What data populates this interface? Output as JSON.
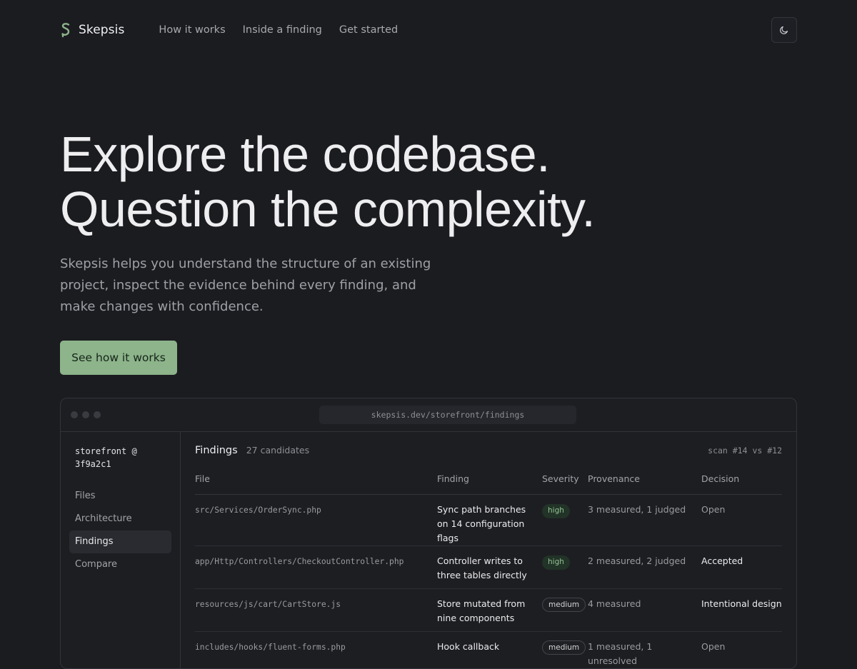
{
  "brand": {
    "name": "Skepsis",
    "accent": "#8db48a"
  },
  "nav": {
    "links": [
      "How it works",
      "Inside a finding",
      "Get started"
    ],
    "theme_icon": "moon-icon"
  },
  "hero": {
    "title_line1": "Explore the codebase.",
    "title_line2": "Question the complexity.",
    "subtitle": "Skepsis helps you understand the structure of an existing project, inspect the evidence behind every finding, and make changes with confidence.",
    "cta": "See how it works"
  },
  "preview": {
    "url": "skepsis.dev/storefront/findings",
    "repo": "storefront @ 3f9a2c1",
    "sidebar": [
      "Files",
      "Architecture",
      "Findings",
      "Compare"
    ],
    "active": "Findings",
    "title": "Findings",
    "count": "27 candidates",
    "scan": "scan #14 vs #12",
    "columns": [
      "File",
      "Finding",
      "Severity",
      "Provenance",
      "Decision"
    ],
    "rows": [
      {
        "file": "src/Services/OrderSync.php",
        "finding": "Sync path branches on 14 configuration flags",
        "severity": "high",
        "provenance": "3 measured, 1 judged",
        "decision": "Open"
      },
      {
        "file": "app/Http/Controllers/CheckoutController.php",
        "finding": "Controller writes to three tables directly",
        "severity": "high",
        "provenance": "2 measured, 2 judged",
        "decision": "Accepted"
      },
      {
        "file": "resources/js/cart/CartStore.js",
        "finding": "Store mutated from nine components",
        "severity": "medium",
        "provenance": "4 measured",
        "decision": "Intentional design"
      },
      {
        "file": "includes/hooks/fluent-forms.php",
        "finding": "Hook callback",
        "severity": "medium",
        "provenance": "1 measured, 1 unresolved",
        "decision": "Open"
      }
    ]
  }
}
